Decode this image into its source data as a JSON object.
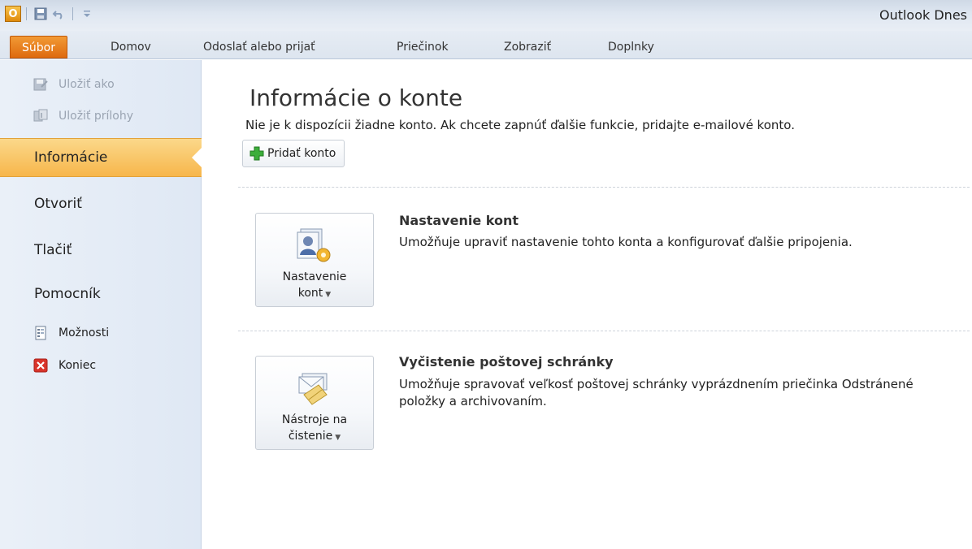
{
  "window": {
    "title": "Outlook Dnes",
    "app_icon_letter": "O"
  },
  "quick_access": [
    {
      "name": "save-icon"
    },
    {
      "name": "undo-icon"
    },
    {
      "name": "customize-qat-icon"
    }
  ],
  "ribbon": {
    "tabs": [
      {
        "label": "Súbor"
      },
      {
        "label": "Domov"
      },
      {
        "label": "Odoslať alebo prijať"
      },
      {
        "label": "Priečinok"
      },
      {
        "label": "Zobraziť"
      },
      {
        "label": "Doplnky"
      }
    ]
  },
  "nav": {
    "save_as": "Uložiť ako",
    "save_attachments": "Uložiť prílohy",
    "info": "Informácie",
    "open": "Otvoriť",
    "print": "Tlačiť",
    "help": "Pomocník",
    "options": "Možnosti",
    "exit": "Koniec"
  },
  "main": {
    "title": "Informácie o konte",
    "description": "Nie je k dispozícii žiadne konto. Ak chcete zapnúť ďalšie funkcie, pridajte e-mailové konto.",
    "add_account": "Pridať konto",
    "sections": [
      {
        "button_line1": "Nastavenie",
        "button_line2": "kont",
        "title": "Nastavenie kont",
        "description": "Umožňuje upraviť nastavenie tohto konta a konfigurovať ďalšie pripojenia."
      },
      {
        "button_line1": "Nástroje na",
        "button_line2": "čistenie",
        "title": "Vyčistenie poštovej schránky",
        "description": "Umožňuje spravovať veľkosť poštovej schránky vyprázdnením priečinka Odstránené položky a archivovaním."
      }
    ]
  },
  "colors": {
    "file_tab": "#e07010",
    "active_nav": "#f9c766",
    "nav_background": "#e4ecf6"
  }
}
